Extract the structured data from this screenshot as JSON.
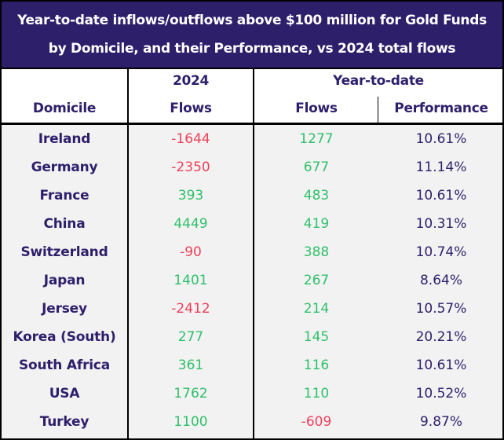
{
  "title": {
    "line1": "Year-to-date inflows/outflows above $100 million for Gold Funds",
    "line2": "by Domicile, and their Performance, vs 2024 total flows"
  },
  "header": {
    "domicile": "Domicile",
    "group_2024": "2024",
    "flows_2024": "Flows",
    "group_ytd": "Year-to-date",
    "flows_ytd": "Flows",
    "performance_ytd": "Performance"
  },
  "colors": {
    "title_band": "#2e1f6b",
    "text_primary": "#2e1f6b",
    "positive": "#2fc06a",
    "negative": "#f0405a",
    "row_background": "#f2f2f2"
  },
  "rows": [
    {
      "domicile": "Ireland",
      "flows_2024": "-1644",
      "flows_ytd": "1277",
      "performance": "10.61%"
    },
    {
      "domicile": "Germany",
      "flows_2024": "-2350",
      "flows_ytd": "677",
      "performance": "11.14%"
    },
    {
      "domicile": "France",
      "flows_2024": "393",
      "flows_ytd": "483",
      "performance": "10.61%"
    },
    {
      "domicile": "China",
      "flows_2024": "4449",
      "flows_ytd": "419",
      "performance": "10.31%"
    },
    {
      "domicile": "Switzerland",
      "flows_2024": "-90",
      "flows_ytd": "388",
      "performance": "10.74%"
    },
    {
      "domicile": "Japan",
      "flows_2024": "1401",
      "flows_ytd": "267",
      "performance": "8.64%"
    },
    {
      "domicile": "Jersey",
      "flows_2024": "-2412",
      "flows_ytd": "214",
      "performance": "10.57%"
    },
    {
      "domicile": "Korea (South)",
      "flows_2024": "277",
      "flows_ytd": "145",
      "performance": "20.21%"
    },
    {
      "domicile": "South Africa",
      "flows_2024": "361",
      "flows_ytd": "116",
      "performance": "10.61%"
    },
    {
      "domicile": "USA",
      "flows_2024": "1762",
      "flows_ytd": "110",
      "performance": "10.52%"
    },
    {
      "domicile": "Turkey",
      "flows_2024": "1100",
      "flows_ytd": "-609",
      "performance": "9.87%"
    }
  ]
}
